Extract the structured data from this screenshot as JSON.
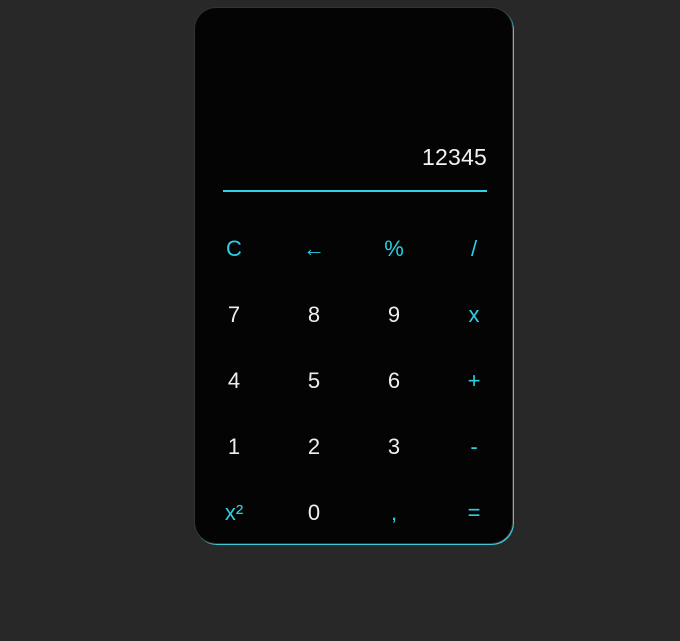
{
  "display": {
    "value": "12345"
  },
  "keys": {
    "row1": {
      "clear": "C",
      "backspace": "←",
      "percent": "%",
      "divide": "/"
    },
    "row2": {
      "seven": "7",
      "eight": "8",
      "nine": "9",
      "multiply": "x"
    },
    "row3": {
      "four": "4",
      "five": "5",
      "six": "6",
      "plus": "+"
    },
    "row4": {
      "one": "1",
      "two": "2",
      "three": "3",
      "minus": "-"
    },
    "row5": {
      "square": "x²",
      "zero": "0",
      "decimal": ",",
      "equals": "="
    }
  },
  "colors": {
    "page_background": "#282828",
    "calculator_background": "#040404",
    "accent": "#2ccfe3",
    "digit_text": "#eeeeee"
  }
}
